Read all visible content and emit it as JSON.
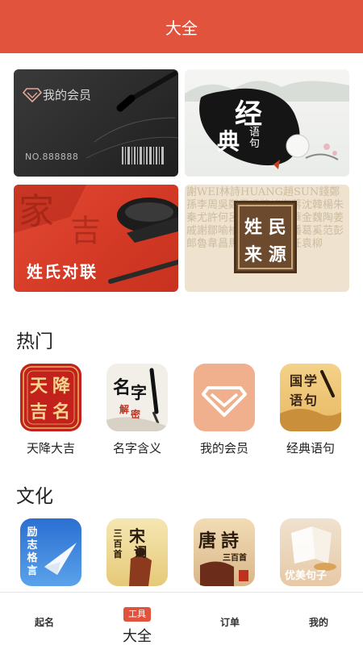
{
  "header": {
    "title": "大全"
  },
  "banners": {
    "member": {
      "title": "我的会员",
      "number": "NO.888888"
    },
    "classic": {
      "chars": [
        "经",
        "典",
        "语句"
      ]
    },
    "couplet": {
      "title": "姓氏对联"
    },
    "origin": {
      "chars": [
        "姓",
        "民",
        "来",
        "源"
      ],
      "background_text": "謝WEI林詩HUANG趙SUN錢鄭孫李周吳鄭王馮陳褚衛蔣沈韓楊朱秦尤許何呂施張孔曹嚴華金魏陶姜戚謝鄒喻柏水竇章雲蘇潘葛奚范彭郎魯韋昌馬苗鳳花方俞任袁柳"
    }
  },
  "sections": [
    {
      "title": "热门",
      "apps": [
        {
          "label": "天降大吉",
          "icon": "tianjiang-icon",
          "icon_text": [
            "天",
            "降",
            "吉",
            "名"
          ]
        },
        {
          "label": "名字含义",
          "icon": "name-meaning-icon",
          "icon_text": [
            "名",
            "字",
            "解",
            "密"
          ]
        },
        {
          "label": "我的会员",
          "icon": "membership-icon"
        },
        {
          "label": "经典语句",
          "icon": "classic-quotes-icon",
          "icon_text": [
            "国",
            "学",
            "语",
            "句"
          ]
        }
      ]
    },
    {
      "title": "文化",
      "apps": [
        {
          "label": "",
          "icon": "inspiration-icon",
          "icon_text": [
            "励",
            "志",
            "格",
            "言"
          ]
        },
        {
          "label": "",
          "icon": "song-ci-icon",
          "icon_text": [
            "宋",
            "词",
            "三",
            "百",
            "首"
          ]
        },
        {
          "label": "",
          "icon": "tang-poems-icon",
          "icon_text": [
            "唐",
            "詩",
            "三",
            "百",
            "首"
          ]
        },
        {
          "label": "",
          "icon": "sentences-icon",
          "icon_text": "优美句子"
        }
      ]
    }
  ],
  "tabbar": {
    "tabs": [
      {
        "label": "起名",
        "active": false
      },
      {
        "label": "大全",
        "active": true,
        "badge": "工具"
      },
      {
        "label": "订单",
        "active": false
      },
      {
        "label": "我的",
        "active": false
      }
    ]
  },
  "colors": {
    "brand": "#e2533d",
    "text": "#222222"
  }
}
